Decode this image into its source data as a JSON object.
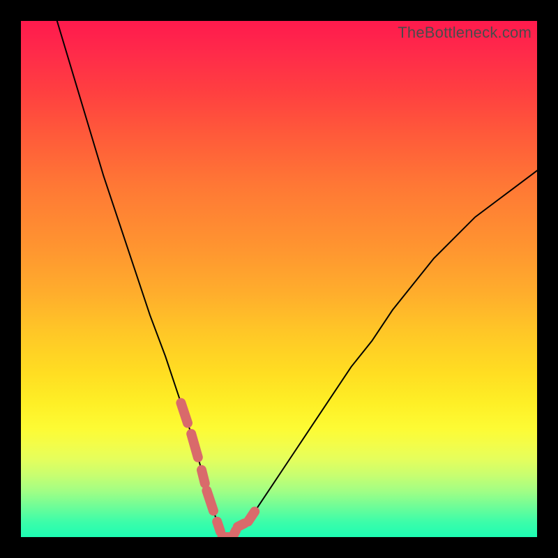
{
  "watermark": "TheBottleneck.com",
  "chart_data": {
    "type": "line",
    "title": "",
    "xlabel": "",
    "ylabel": "",
    "xlim": [
      0,
      100
    ],
    "ylim": [
      0,
      100
    ],
    "grid": false,
    "background_gradient": {
      "direction": "vertical",
      "stops": [
        {
          "pos": 0,
          "color": "#ff1a4d"
        },
        {
          "pos": 44,
          "color": "#ff9530"
        },
        {
          "pos": 74,
          "color": "#feef26"
        },
        {
          "pos": 100,
          "color": "#1dfdb3"
        }
      ],
      "note": "y=0 at top (red) to y=100 at bottom (teal-green); color encodes bottleneck severity"
    },
    "series": [
      {
        "name": "bottleneck-curve",
        "note": "V-shaped curve; y=0 near optimum around x≈38, rising toward 100 at the x-extremes. Approximate values read from pixel positions.",
        "x": [
          7,
          10,
          13,
          16,
          19,
          22,
          25,
          28,
          31,
          33,
          35,
          36,
          38,
          39,
          41,
          42,
          44,
          46,
          48,
          52,
          56,
          60,
          64,
          68,
          72,
          76,
          80,
          84,
          88,
          92,
          96,
          100
        ],
        "y": [
          100,
          90,
          80,
          70,
          61,
          52,
          43,
          35,
          26,
          20,
          13,
          9,
          3,
          0,
          0,
          2,
          3,
          6,
          9,
          15,
          21,
          27,
          33,
          38,
          44,
          49,
          54,
          58,
          62,
          65,
          68,
          71
        ]
      }
    ],
    "highlight": {
      "name": "near-minimum-dots",
      "note": "Thick salmon overlay on the curve near the trough (approx x 31–46), dotted/segmented appearance.",
      "x": [
        31,
        33,
        35,
        36,
        38,
        39,
        41,
        42,
        44,
        46
      ],
      "y": [
        26,
        20,
        13,
        9,
        3,
        0,
        0,
        2,
        3,
        6
      ]
    }
  }
}
